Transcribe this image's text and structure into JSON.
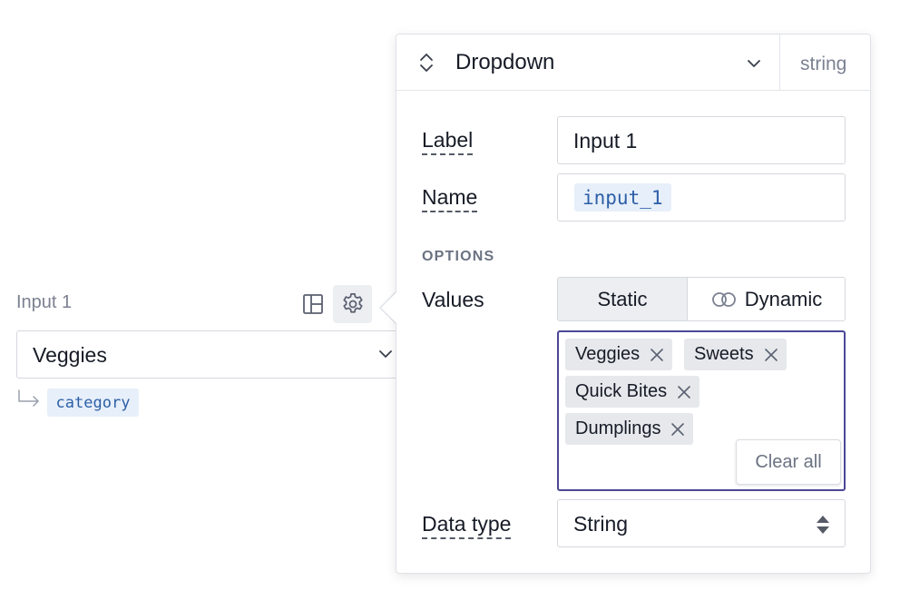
{
  "widget": {
    "label": "Input 1",
    "selected_value": "Veggies",
    "variable": "category",
    "icons": {
      "layout": "layout-panel-icon",
      "settings": "gear-icon",
      "chevron": "chevron-down-icon",
      "return": "return-arrow-icon"
    }
  },
  "panel": {
    "type_title": "Dropdown",
    "data_type_badge": "string",
    "label_field": {
      "label": "Label",
      "value": "Input 1"
    },
    "name_field": {
      "label": "Name",
      "value": "input_1"
    },
    "options_heading": "OPTIONS",
    "values_label": "Values",
    "values_modes": [
      "Static",
      "Dynamic"
    ],
    "active_mode": "Static",
    "tags": [
      "Veggies",
      "Sweets",
      "Quick Bites",
      "Dumplings"
    ],
    "clear_all_label": "Clear all",
    "data_type_field": {
      "label": "Data type",
      "value": "String"
    }
  },
  "colors": {
    "accent_border": "#4b4797",
    "chip_bg": "#e7effa",
    "chip_text": "#2c5fa6",
    "tag_bg": "#e6e8ec"
  }
}
